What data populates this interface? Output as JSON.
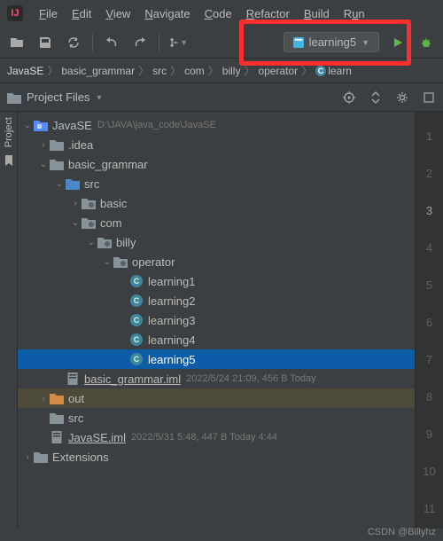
{
  "menu": {
    "file": "File",
    "edit": "Edit",
    "view": "View",
    "navigate": "Navigate",
    "code": "Code",
    "refactor": "Refactor",
    "build": "Build",
    "run": "Run"
  },
  "run_config": {
    "label": "learning5"
  },
  "breadcrumb": {
    "root": "JavaSE",
    "p1": "basic_grammar",
    "p2": "src",
    "p3": "com",
    "p4": "billy",
    "p5": "operator",
    "last": "learn"
  },
  "panel": {
    "title": "Project Files"
  },
  "tree": {
    "root": {
      "name": "JavaSE",
      "path": "D:\\JAVA\\java_code\\JavaSE"
    },
    "idea": ".idea",
    "basic_grammar": "basic_grammar",
    "src": "src",
    "basic": "basic",
    "com": "com",
    "billy": "billy",
    "operator": "operator",
    "l1": "learning1",
    "l2": "learning2",
    "l3": "learning3",
    "l4": "learning4",
    "l5": "learning5",
    "bg_iml": {
      "name": "basic_grammar.iml",
      "meta": "2022/5/24 21:09, 456 B Today"
    },
    "out": "out",
    "src2": "src",
    "se_iml": {
      "name": "JavaSE.iml",
      "meta": "2022/5/31 5:48, 447 B Today 4:44"
    },
    "ext": "Extensions"
  },
  "gutter": [
    "1",
    "2",
    "3",
    "4",
    "5",
    "6",
    "7",
    "8",
    "9",
    "10",
    "11"
  ],
  "watermark": "CSDN @Billyhz"
}
